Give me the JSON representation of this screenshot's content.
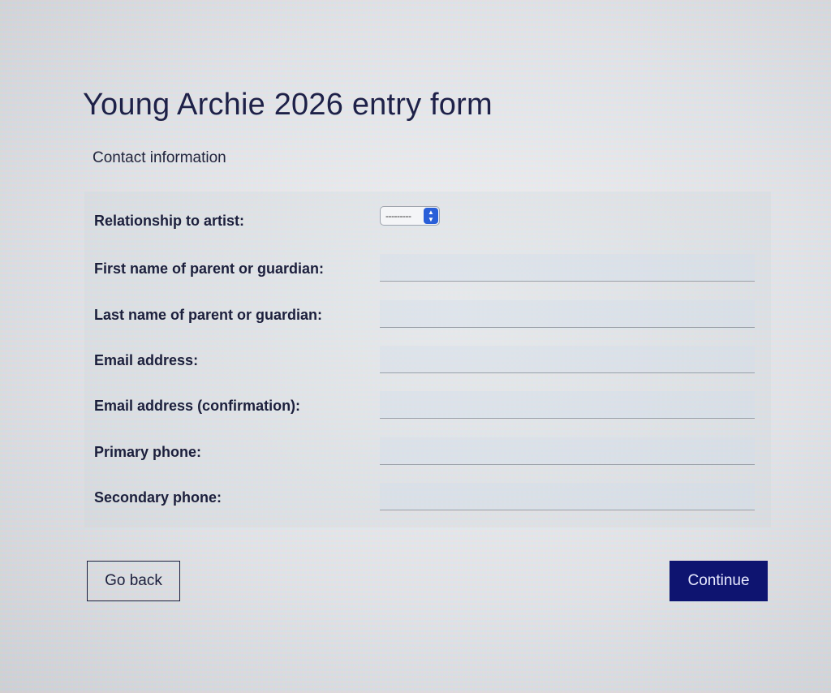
{
  "page": {
    "title": "Young Archie 2026 entry form",
    "section_title": "Contact information"
  },
  "form": {
    "relationship": {
      "label": "Relationship to artist:",
      "selected_value": "---------"
    },
    "first_name": {
      "label": "First name of parent or guardian:",
      "value": ""
    },
    "last_name": {
      "label": "Last name of parent or guardian:",
      "value": ""
    },
    "email": {
      "label": "Email address:",
      "value": ""
    },
    "email_confirmation": {
      "label": "Email address (confirmation):",
      "value": ""
    },
    "primary_phone": {
      "label": "Primary phone:",
      "value": ""
    },
    "secondary_phone": {
      "label": "Secondary phone:",
      "value": ""
    }
  },
  "buttons": {
    "back_label": "Go back",
    "continue_label": "Continue"
  },
  "colors": {
    "primary_button": "#0e1470",
    "select_accent": "#2a5fd8",
    "heading_text": "#1e2148"
  },
  "icons": {
    "select_arrow": "up-down-chevron-icon"
  }
}
